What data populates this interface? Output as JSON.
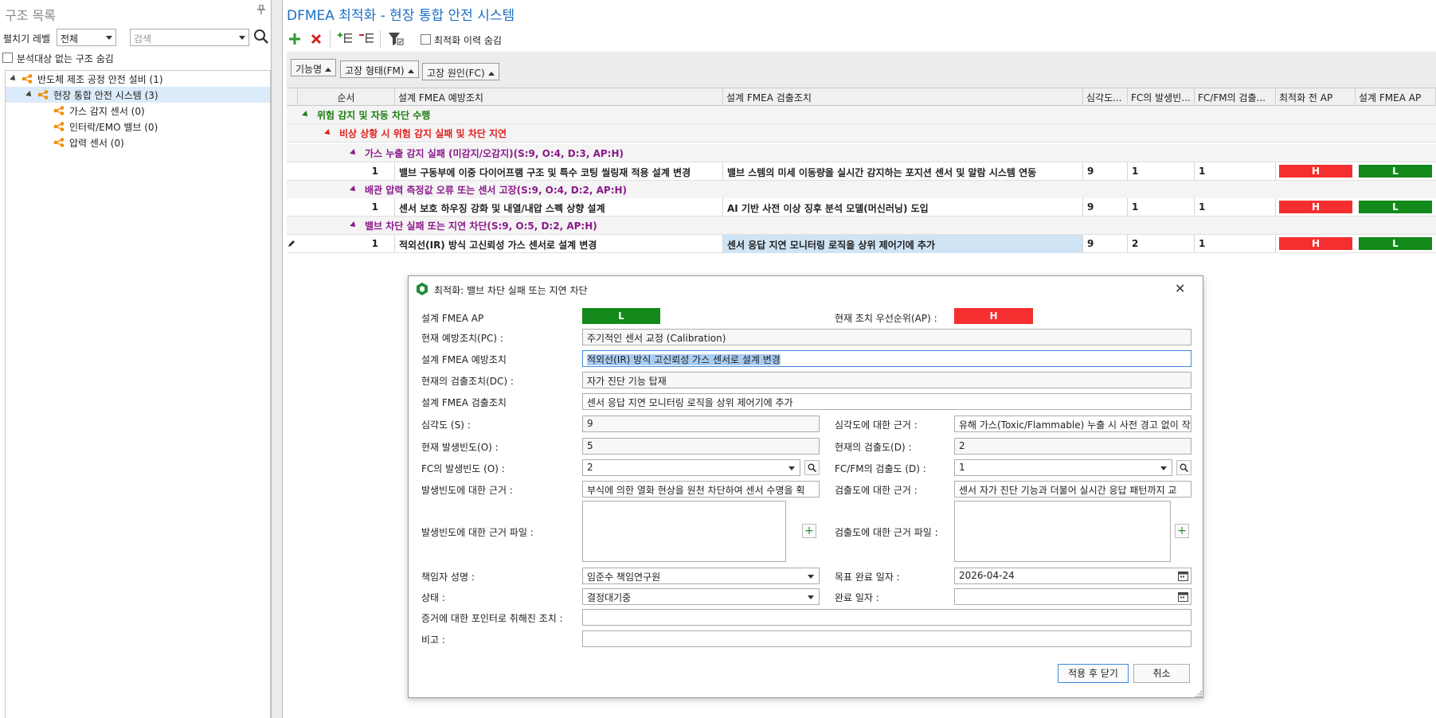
{
  "left_panel": {
    "title": "구조 목록",
    "pin_icon": "pin-icon",
    "expand_level_label": "펼치기 레벨",
    "expand_level_value": "전체",
    "search_placeholder": "검색",
    "hide_unanalyzed_label": "분석대상 없는 구조 숨김",
    "tree": [
      {
        "label": "반도체 제조 공정 안전 설비 (1)",
        "level": 0
      },
      {
        "label": "현장 통합 안전 시스템 (3)",
        "level": 1,
        "selected": true
      },
      {
        "label": "가스 감지 센서 (0)",
        "level": 2
      },
      {
        "label": "인터락/EMO 밸브 (0)",
        "level": 2
      },
      {
        "label": "압력 센서 (0)",
        "level": 2
      }
    ]
  },
  "main": {
    "title": "DFMEA 최적화 - 현장 통합 안전 시스템",
    "hide_history_label": "최적화 이력 숨김",
    "group_chips": [
      "기능명",
      "고장 형태(FM)",
      "고장 원인(FC)"
    ],
    "columns": [
      "순서",
      "설계 FMEA 예방조치",
      "설계 FMEA 검출조치",
      "심각도...",
      "FC의 발생빈...",
      "FC/FM의 검출...",
      "최적화 전 AP",
      "설계 FMEA AP"
    ],
    "group_function": "위험 감지 및 자동 차단 수행",
    "group_failure_mode": "비상 상황 시 위험 감지 실패 및 차단 지연",
    "groups": [
      {
        "cause": "가스 누출 감지 실패 (미감지/오감지)(S:9, O:4, D:3, AP:H)",
        "row": {
          "seq": "1",
          "prevention": "밸브 구동부에 이중 다이어프램 구조 및 특수 코팅 씰링재 적용 설계 변경",
          "detection": "밸브 스템의 미세 이동량을 실시간 감지하는 포지션 센서 및 알람 시스템 연동",
          "severity": "9",
          "occurrence": "1",
          "detectability": "1",
          "ap_before": "H",
          "ap_after": "L"
        }
      },
      {
        "cause": "배관 압력 측정값 오류 또는 센서 고장(S:9, O:4, D:2, AP:H)",
        "row": {
          "seq": "1",
          "prevention": "센서 보호 하우징 강화 및 내열/내압 스펙 상향 설계",
          "detection": "AI 기반 사전 이상 징후 분석 모델(머신러닝) 도입",
          "severity": "9",
          "occurrence": "1",
          "detectability": "1",
          "ap_before": "H",
          "ap_after": "L"
        }
      },
      {
        "cause": "밸브 차단 실패 또는 지연 차단(S:9, O:5, D:2, AP:H)",
        "row": {
          "seq": "1",
          "prevention": "적외선(IR) 방식 고신뢰성 가스 센서로 설계 변경",
          "detection": "센서 응답 지연 모니터링 로직을 상위 제어기에 추가",
          "severity": "9",
          "occurrence": "2",
          "detectability": "1",
          "ap_before": "H",
          "ap_after": "L"
        }
      }
    ],
    "colors": {
      "ap_high": "#f52f2f",
      "ap_low": "#12891a",
      "function_green": "#1c7d12",
      "fm_red": "#e0201e",
      "fc_purple": "#8b1a8b",
      "accent_blue": "#1a6fc4"
    }
  },
  "dialog": {
    "title": "최적화: 밸브 차단 실패 또는 지연 차단",
    "design_ap_label": "설계 FMEA AP",
    "design_ap_value": "L",
    "current_ap_label": "현재 조치 우선순위(AP) :",
    "current_ap_value": "H",
    "current_pc_label": "현재 예방조치(PC) :",
    "current_pc_value": "주기적인 센서 교정 (Calibration)",
    "design_prevention_label": "설계 FMEA 예방조치",
    "design_prevention_value": "적외선(IR) 방식 고신뢰성 가스 센서로 설계 변경",
    "current_dc_label": "현재의 검출조치(DC) :",
    "current_dc_value": "자가 진단 기능 탑재",
    "design_detection_label": "설계 FMEA 검출조치",
    "design_detection_value": "센서 응답 지연 모니터링 로직을 상위 제어기에 추가",
    "severity_label": "심각도 (S) :",
    "severity_value": "9",
    "severity_basis_label": "심각도에 대한 근거 :",
    "severity_basis_value": "유해 가스(Toxic/Flammable) 누출 시 사전 경고 없이 작",
    "current_occurrence_label": "현재 발생빈도(O) :",
    "current_occurrence_value": "5",
    "current_detection_label": "현재의 검출도(D) :",
    "current_detection_value": "2",
    "fc_occurrence_label": "FC의 발생빈도 (O) :",
    "fc_occurrence_value": "2",
    "fcfm_detection_label": "FC/FM의 검출도 (D) :",
    "fcfm_detection_value": "1",
    "occurrence_basis_label": "발생빈도에 대한 근거 :",
    "occurrence_basis_value": "부식에 의한 열화 현상을 원천 차단하여 센서 수명을 획",
    "detection_basis_label": "검출도에 대한 근거 :",
    "detection_basis_value": "센서 자가 진단 기능과 더불어 실시간 응답 패턴까지 교",
    "occurrence_file_label": "발생빈도에 대한 근거 파일 :",
    "detection_file_label": "검출도에 대한 근거 파일 :",
    "owner_label": "책임자 성명 :",
    "owner_value": "임준수 책임연구원",
    "target_date_label": "목표 완료 일자 :",
    "target_date_value": "2026-04-24",
    "status_label": "상태 :",
    "status_value": "결정대기중",
    "completion_date_label": "완료 일자 :",
    "completion_date_value": "",
    "evidence_label": "증거에 대한 포인터로 취해진 조치 :",
    "evidence_value": "",
    "remarks_label": "비고 :",
    "remarks_value": "",
    "apply_close_label": "적용 후 닫기",
    "cancel_label": "취소"
  }
}
